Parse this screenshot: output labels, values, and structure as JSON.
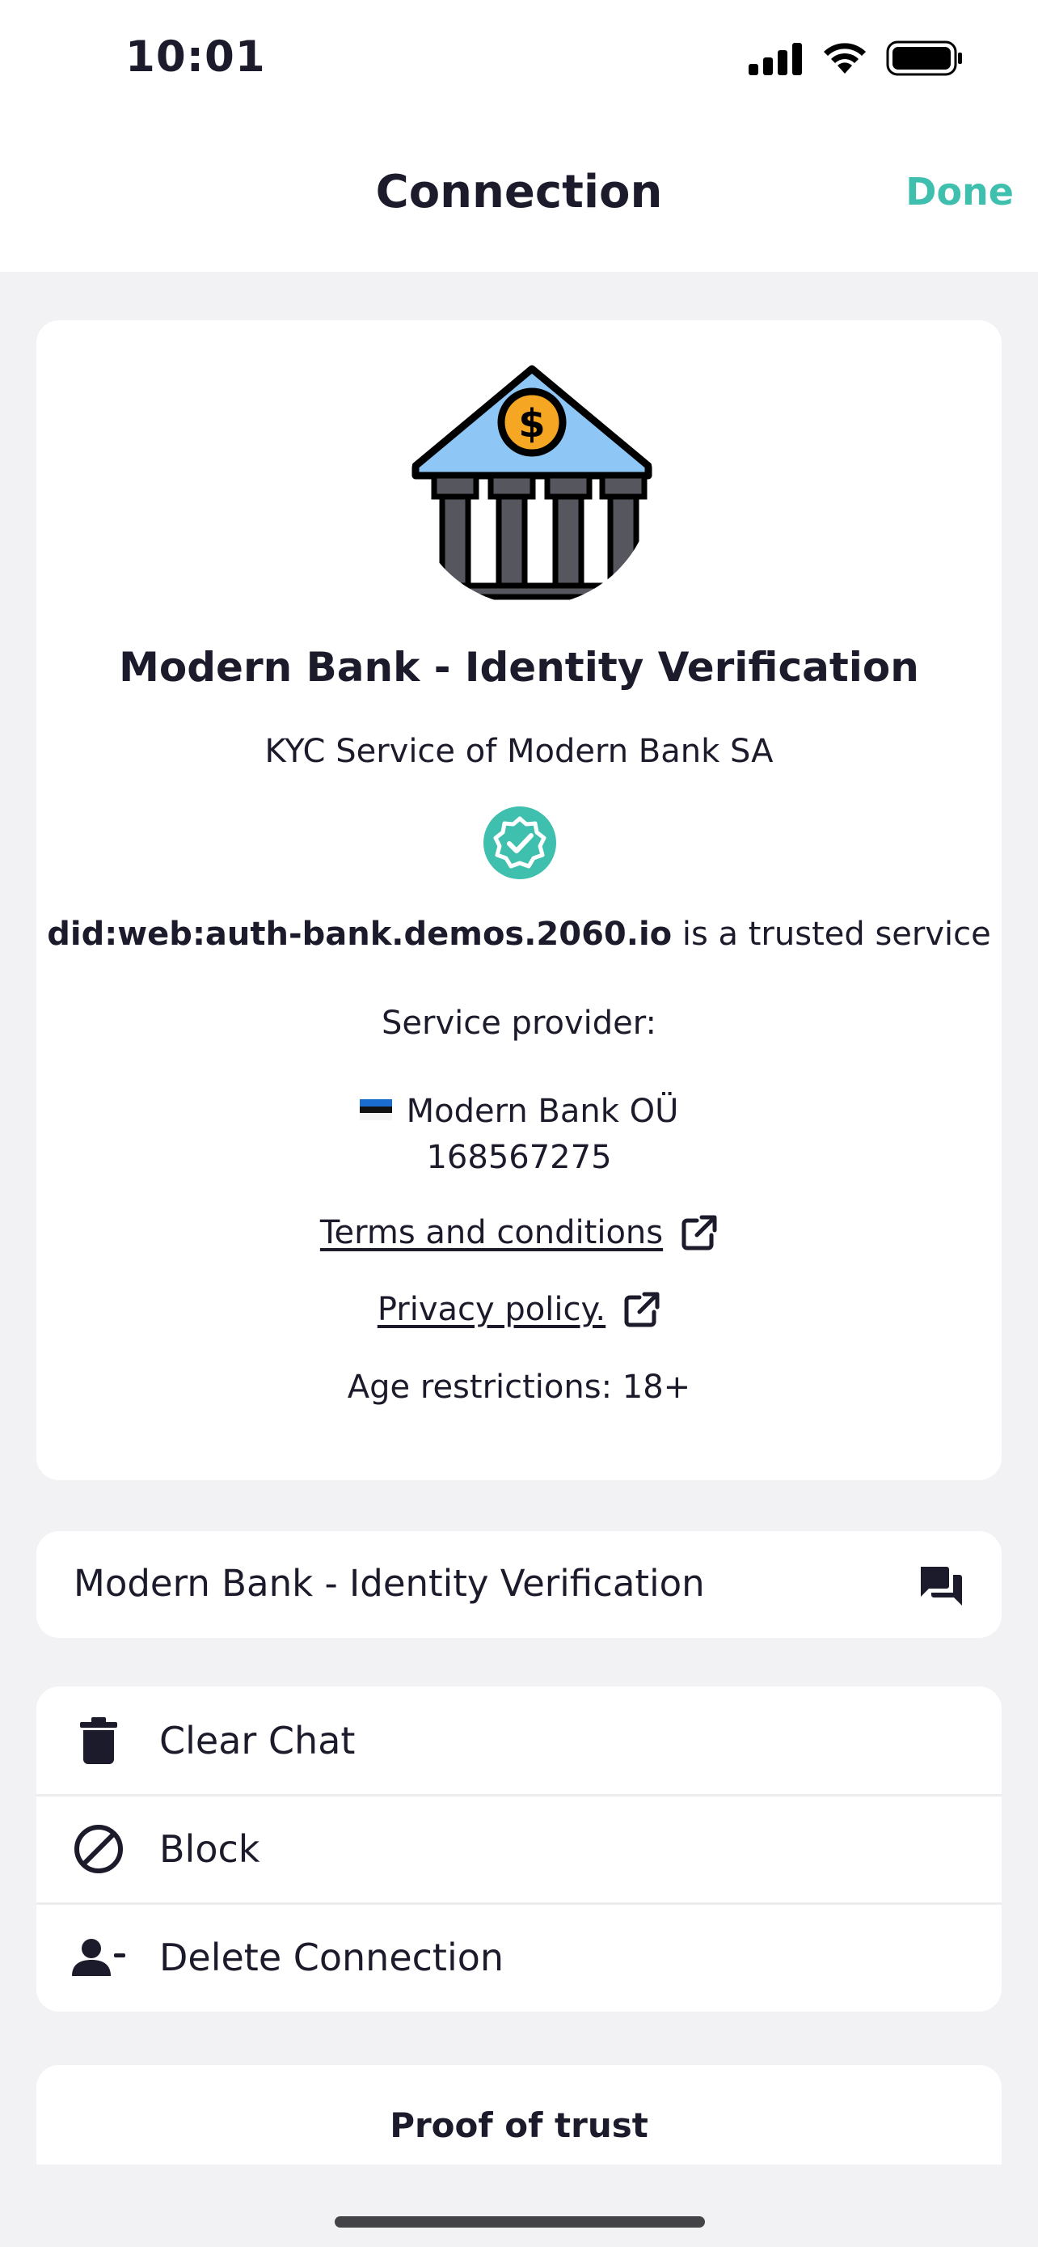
{
  "status_bar": {
    "time": "10:01"
  },
  "nav": {
    "title": "Connection",
    "done_label": "Done"
  },
  "service": {
    "name": "Modern Bank - Identity Verification",
    "description": "KYC Service of Modern Bank SA",
    "did": "did:web:auth-bank.demos.2060.io",
    "trusted_suffix": " is a trusted service",
    "provider_label": "Service provider:",
    "provider_name": "Modern Bank OÜ",
    "provider_id": "168567275",
    "terms_label": "Terms and conditions",
    "privacy_label": "Privacy policy.",
    "age_restrictions": "Age restrictions: 18+"
  },
  "chat_row": {
    "label": "Modern Bank - Identity Verification"
  },
  "actions": [
    {
      "label": "Clear Chat",
      "icon": "trash-icon"
    },
    {
      "label": "Block",
      "icon": "block-icon"
    },
    {
      "label": "Delete Connection",
      "icon": "remove-user-icon"
    }
  ],
  "proof": {
    "title": "Proof of trust"
  },
  "colors": {
    "accent": "#3fbfae",
    "background": "#f2f2f4",
    "card": "#ffffff",
    "text": "#1c1b2b",
    "bank_roof": "#8ec7f5",
    "bank_coin": "#f5a623",
    "bank_pillars": "#55565e"
  }
}
